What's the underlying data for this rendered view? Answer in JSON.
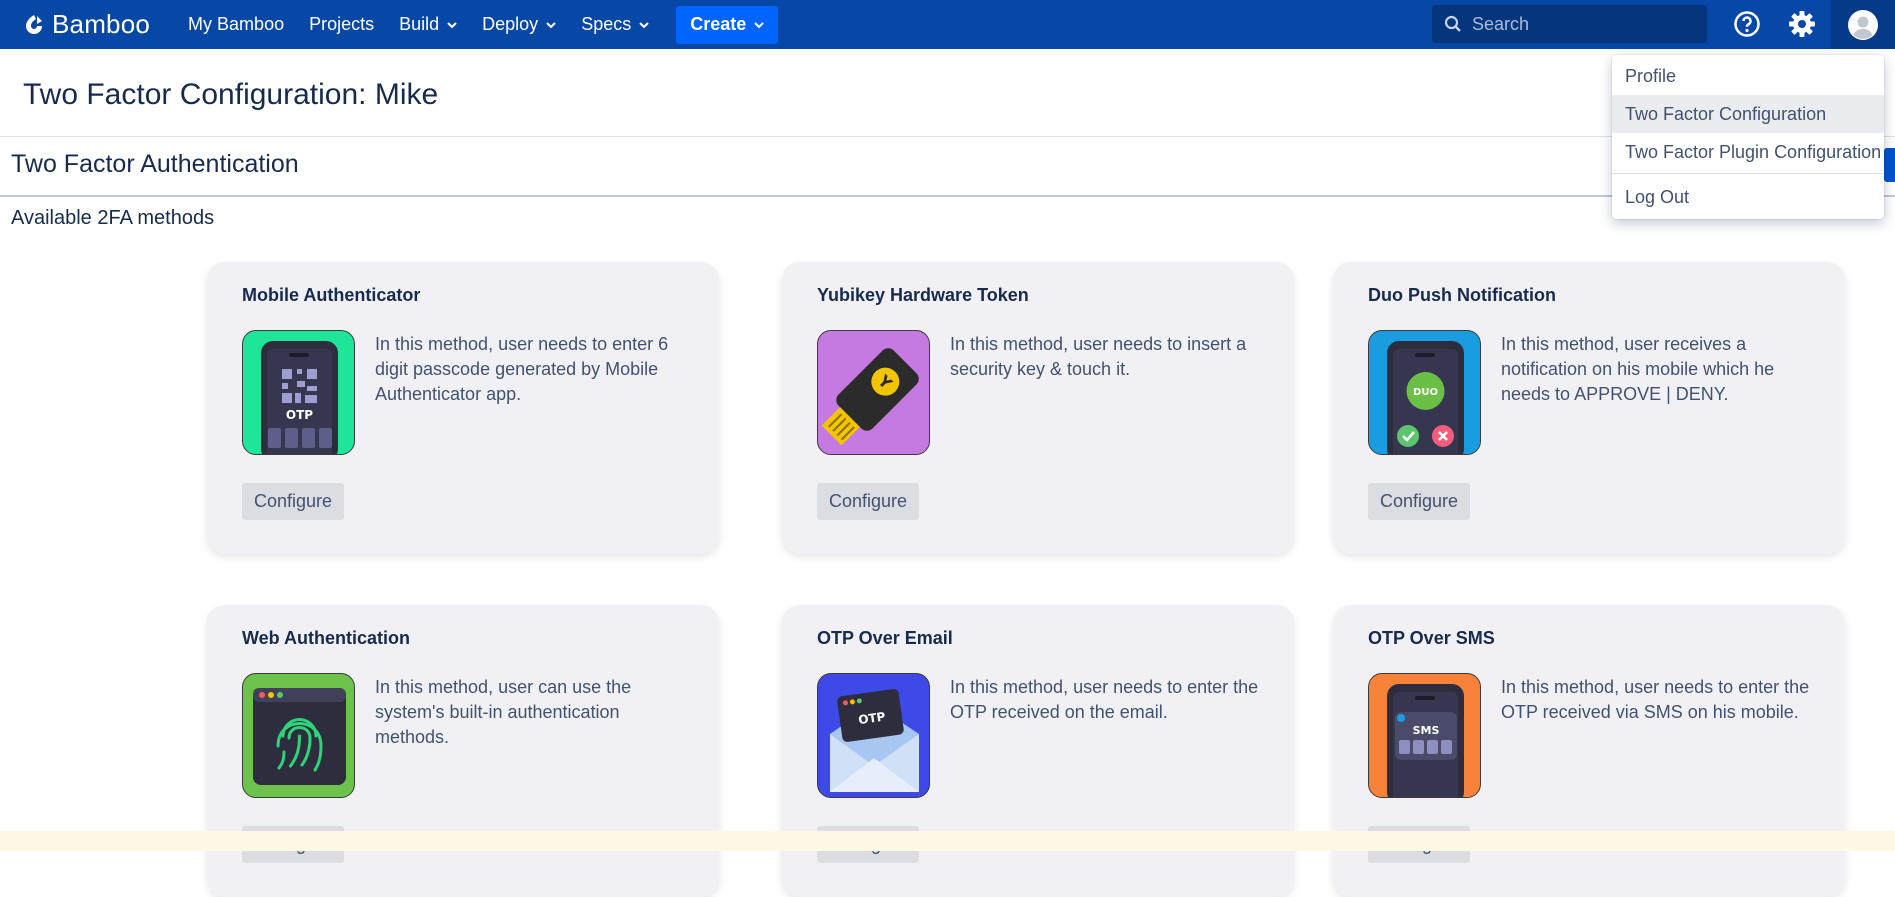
{
  "topbar": {
    "brand": "Bamboo",
    "nav": [
      "My Bamboo",
      "Projects",
      "Build",
      "Deploy",
      "Specs"
    ],
    "create_label": "Create",
    "search_placeholder": "Search"
  },
  "page": {
    "title": "Two Factor Configuration: Mike",
    "section_title": "Two Factor Authentication",
    "sub_label": "Available 2FA methods"
  },
  "methods": [
    {
      "title": "Mobile Authenticator",
      "desc": "In this method, user needs to enter 6 digit passcode generated by Mobile Authenticator app.",
      "button": "Configure",
      "color": "#1ee598",
      "icon_text": "OTP"
    },
    {
      "title": "Yubikey Hardware Token",
      "desc": "In this method, user needs to insert a security key & touch it.",
      "button": "Configure",
      "color": "#c57ae2",
      "icon_text": "Y"
    },
    {
      "title": "Duo Push Notification",
      "desc": "In this method, user receives a notification on his mobile which he needs to APPROVE | DENY.",
      "button": "Configure",
      "color": "#1a9de0",
      "icon_text": "DUO"
    },
    {
      "title": "Web Authentication",
      "desc": "In this method, user can use the system's built-in authentication methods.",
      "button": "Configure",
      "color": "#6cc24a"
    },
    {
      "title": "OTP Over Email",
      "desc": "In this method, user needs to enter the OTP received on the email.",
      "button": "Configure",
      "color": "#3e49e8",
      "icon_text": "OTP"
    },
    {
      "title": "OTP Over SMS",
      "desc": "In this method, user needs to enter the OTP received via SMS on his mobile.",
      "button": "Configure",
      "color": "#f7823a",
      "icon_text": "SMS"
    }
  ],
  "dropdown": {
    "items": [
      "Profile",
      "Two Factor Configuration",
      "Two Factor Plugin Configuration",
      "Log Out"
    ]
  }
}
